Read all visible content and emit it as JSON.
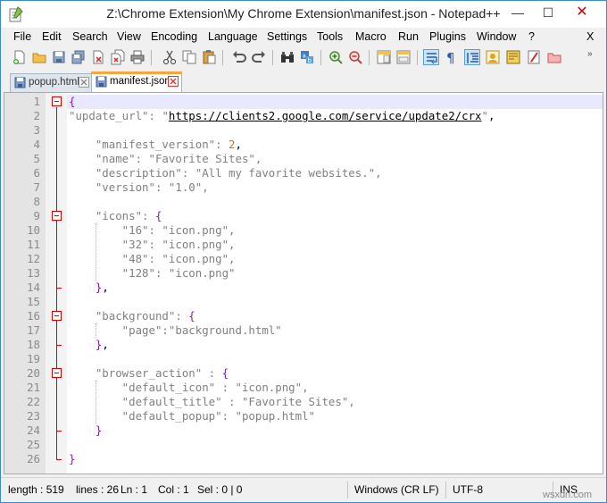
{
  "window": {
    "title": "Z:\\Chrome Extension\\My Chrome Extension\\manifest.json - Notepad++",
    "minimize": "—",
    "maximize": "☐",
    "close": "✕"
  },
  "menu": {
    "items": [
      "File",
      "Edit",
      "Search",
      "View",
      "Encoding",
      "Language",
      "Settings",
      "Tools",
      "Macro",
      "Run",
      "Plugins",
      "Window",
      "?"
    ],
    "close": "X"
  },
  "toolbar": {
    "icons": [
      "new-file-icon",
      "open-file-icon",
      "save-icon",
      "save-all-icon",
      "close-icon",
      "close-all-icon",
      "print-icon",
      "cut-icon",
      "copy-icon",
      "paste-icon",
      "undo-icon",
      "redo-icon",
      "find-icon",
      "replace-icon",
      "zoom-in-icon",
      "zoom-out-icon",
      "sync-vertical-icon",
      "sync-horizontal-icon",
      "word-wrap-icon",
      "show-all-chars-icon",
      "indent-guide-icon",
      "user-language-icon",
      "document-map-icon",
      "function-list-icon",
      "folder-workspace-icon"
    ],
    "more": "»"
  },
  "tabs": [
    {
      "label": "popup.html",
      "active": false
    },
    {
      "label": "manifest.json",
      "active": true
    }
  ],
  "editor": {
    "line_numbers": [
      "1",
      "2",
      "3",
      "4",
      "5",
      "6",
      "7",
      "8",
      "9",
      "10",
      "11",
      "12",
      "13",
      "14",
      "15",
      "16",
      "17",
      "18",
      "19",
      "20",
      "21",
      "22",
      "23",
      "24",
      "25",
      "26"
    ],
    "lines": [
      [
        {
          "t": "{",
          "c": "b"
        }
      ],
      [
        {
          "t": "\"update_url\": ",
          "c": "s"
        },
        {
          "t": "\"",
          "c": "s"
        },
        {
          "t": "https://clients2.google.com/service/update2/crx",
          "c": "url"
        },
        {
          "t": "\"",
          "c": "s"
        },
        {
          "t": ",",
          "c": "p"
        }
      ],
      [],
      [
        {
          "t": "    \"manifest_version\": ",
          "c": "s"
        },
        {
          "t": "2",
          "c": "n"
        },
        {
          "t": ",",
          "c": "p"
        }
      ],
      [
        {
          "t": "    \"name\": \"Favorite Sites\",",
          "c": "s"
        }
      ],
      [
        {
          "t": "    \"description\": \"All my favorite websites.\",",
          "c": "s"
        }
      ],
      [
        {
          "t": "    \"version\": \"1.0\",",
          "c": "s"
        }
      ],
      [],
      [
        {
          "t": "    \"icons\": ",
          "c": "s"
        },
        {
          "t": "{",
          "c": "b"
        }
      ],
      [
        {
          "t": "        \"16\": \"icon.png\",",
          "c": "s"
        }
      ],
      [
        {
          "t": "        \"32\": \"icon.png\",",
          "c": "s"
        }
      ],
      [
        {
          "t": "        \"48\": \"icon.png\",",
          "c": "s"
        }
      ],
      [
        {
          "t": "        \"128\": \"icon.png\"",
          "c": "s"
        }
      ],
      [
        {
          "t": "    ",
          "c": "p"
        },
        {
          "t": "}",
          "c": "b"
        },
        {
          "t": ",",
          "c": "p"
        }
      ],
      [],
      [
        {
          "t": "    \"background\": ",
          "c": "s"
        },
        {
          "t": "{",
          "c": "b"
        }
      ],
      [
        {
          "t": "        \"page\":\"background.html\"",
          "c": "s"
        }
      ],
      [
        {
          "t": "    ",
          "c": "p"
        },
        {
          "t": "}",
          "c": "b"
        },
        {
          "t": ",",
          "c": "p"
        }
      ],
      [],
      [
        {
          "t": "    \"browser_action\" : ",
          "c": "s"
        },
        {
          "t": "{",
          "c": "b"
        }
      ],
      [
        {
          "t": "        \"default_icon\" : \"icon.png\",",
          "c": "s"
        }
      ],
      [
        {
          "t": "        \"default_title\" : \"Favorite Sites\",",
          "c": "s"
        }
      ],
      [
        {
          "t": "        \"default_popup\": \"popup.html\"",
          "c": "s"
        }
      ],
      [
        {
          "t": "    ",
          "c": "p"
        },
        {
          "t": "}",
          "c": "b"
        }
      ],
      [],
      [
        {
          "t": "}",
          "c": "b"
        }
      ]
    ]
  },
  "status": {
    "length": "length : 519",
    "lines": "lines : 26",
    "ln": "Ln : 1",
    "col": "Col : 1",
    "sel": "Sel : 0 | 0",
    "eol": "Windows (CR LF)",
    "encoding": "UTF-8",
    "mode": "INS"
  },
  "watermark": "wsxdn.com",
  "colors": {
    "string": "#808080",
    "brace": "#7b1fa2",
    "number": "#e67300",
    "fold_marker": "#dd0000",
    "active_tab_accent": "#f9a53b"
  }
}
